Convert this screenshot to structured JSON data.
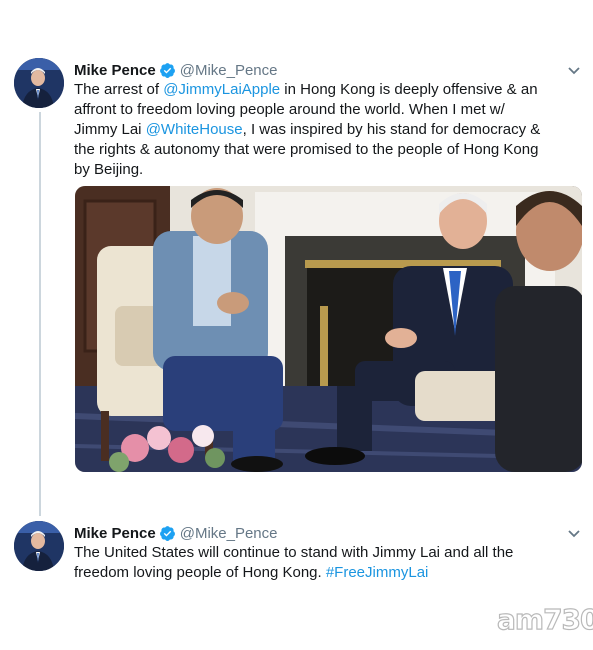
{
  "colors": {
    "text": "#14171a",
    "secondary": "#657786",
    "link": "#1b95e0",
    "verified": "#1da1f2",
    "thread_line": "#ccd6dd"
  },
  "tweets": [
    {
      "author": {
        "name": "Mike Pence",
        "handle": "@Mike_Pence",
        "verified_icon": "verified-badge-icon"
      },
      "text_lines": [
        {
          "before": "The arrest of ",
          "mention": "@JimmyLaiApple",
          "after": " in Hong Kong is deeply offensive & an"
        },
        {
          "before": "affront to freedom loving people around the world. When I met w/",
          "mention": "",
          "after": ""
        },
        {
          "before": "Jimmy Lai ",
          "mention": "@WhiteHouse",
          "after": ", I was inspired by his stand for democracy &"
        },
        {
          "before": "the rights & autonomy that were promised to the people of Hong Kong",
          "mention": "",
          "after": ""
        },
        {
          "before": "by Beijing.",
          "mention": "",
          "after": ""
        }
      ],
      "media": "meeting-photo"
    },
    {
      "author": {
        "name": "Mike Pence",
        "handle": "@Mike_Pence",
        "verified_icon": "verified-badge-icon"
      },
      "text_lines": [
        {
          "before": "The United States will continue to stand with Jimmy Lai and all the",
          "mention": "",
          "after": ""
        },
        {
          "before": "freedom loving people of Hong Kong. ",
          "mention": "#FreeJimmyLai",
          "after": ""
        }
      ]
    }
  ],
  "watermark": "am730"
}
